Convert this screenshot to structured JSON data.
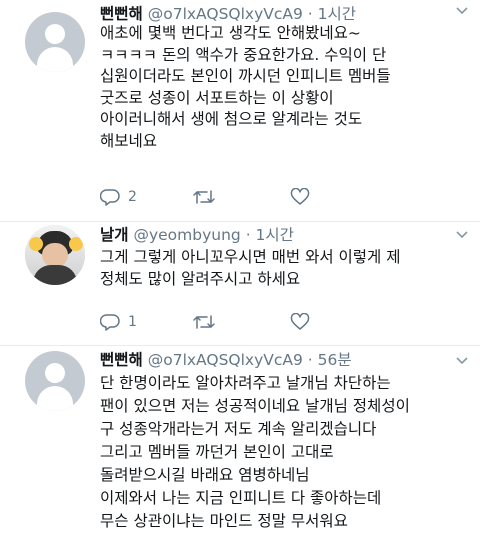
{
  "tweets": [
    {
      "author": "뻔뻔해",
      "handle": "@o7lxAQSQlxyVcA9",
      "time": "· 1시간",
      "lines": [
        "애초에 몇백 번다고 생각도 안해봤네요~",
        "ㅋㅋㅋㅋ 돈의 액수가 중요한가요. 수익이 단",
        "십원이더라도 본인이 까시던 인피니트 멤버들",
        "굿즈로 성종이 서포트하는 이 상황이",
        "아이러니해서 생에 첨으로 알계라는 것도",
        "해보네요"
      ],
      "reply_count": "2",
      "retweet_count": "",
      "like_count": ""
    },
    {
      "author": "날개",
      "handle": "@yeombyung",
      "time": "· 1시간",
      "lines": [
        "그게 그렇게 아니꼬우시면 매번 와서 이렇게 제",
        "정체도 많이 알려주시고 하세요"
      ],
      "reply_count": "1",
      "retweet_count": "",
      "like_count": ""
    },
    {
      "author": "뻔뻔해",
      "handle": "@o7lxAQSQlxyVcA9",
      "time": "· 56분",
      "lines": [
        "단 한명이라도 알아차려주고 날개님 차단하는",
        "팬이 있으면 저는 성공적이네요 날개님 정체성이",
        "구 성종악개라는거 저도 계속 알리겠습니다",
        "그리고 멤버들 까던거 본인이 고대로",
        "돌려받으시길 바래요 염병하네님",
        "이제와서 나는 지금 인피니트 다 좋아하는데",
        "무슨 상관이냐는 마인드 정말 무서워요"
      ]
    }
  ],
  "icons": {
    "reply": "reply-icon",
    "retweet": "retweet-icon",
    "like": "like-icon",
    "caret": "chevron-down-icon"
  },
  "colors": {
    "text": "#14171a",
    "muted": "#657786",
    "divider": "#e6ecf0"
  }
}
